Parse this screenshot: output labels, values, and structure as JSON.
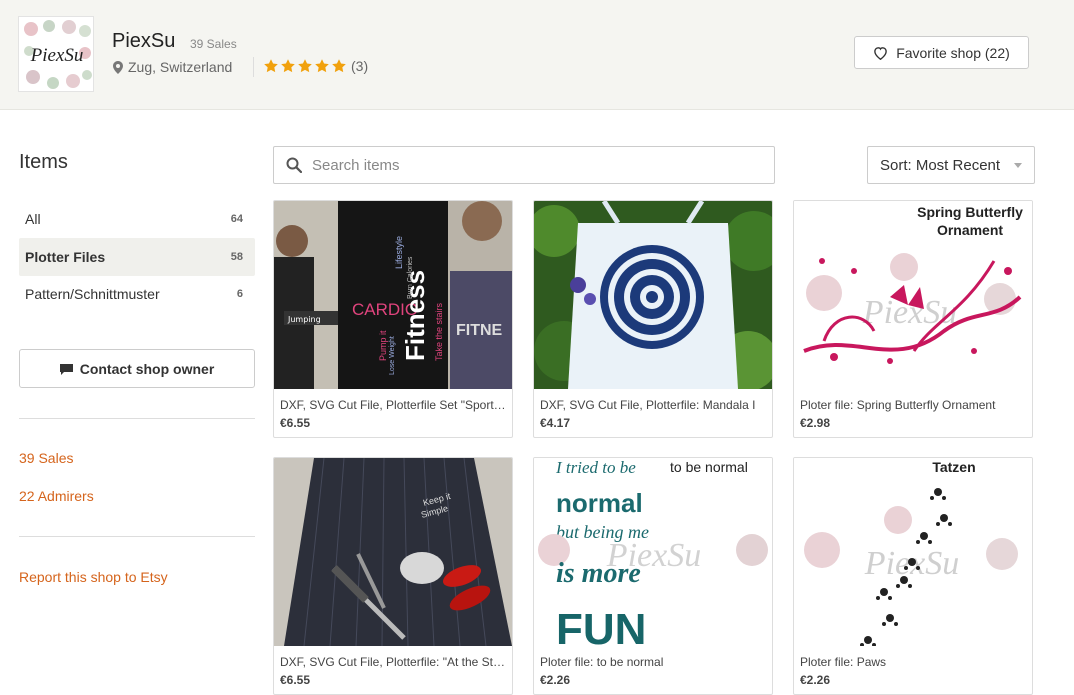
{
  "shop": {
    "name": "PiexSu",
    "sales_small": "39 Sales",
    "location": "Zug, Switzerland",
    "rating_stars": 5,
    "rating_count": "(3)",
    "favorite_label": "Favorite shop (22)",
    "logo_text": "PiexSu"
  },
  "sidebar": {
    "title": "Items",
    "items": [
      {
        "label": "All",
        "count": "64"
      },
      {
        "label": "Plotter Files",
        "count": "58"
      },
      {
        "label": "Pattern/Schnittmuster",
        "count": "6"
      }
    ],
    "contact_label": "Contact shop owner",
    "sales_link": "39 Sales",
    "admirers_link": "22 Admirers",
    "report_link": "Report this shop to Etsy"
  },
  "search": {
    "placeholder": "Search items"
  },
  "sort": {
    "label": "Sort: Most Recent"
  },
  "products": [
    {
      "title": "DXF, SVG Cut File, Plotterfile Set \"Sport Fitness\"",
      "price": "€6.55",
      "image_text": [
        "Lifestyle",
        "CARDIO",
        "Fitness",
        "Take the stairs",
        "Pump it",
        "Lose Weight",
        "FITNE",
        "Burn Calories",
        "Jumping"
      ]
    },
    {
      "title": "DXF, SVG Cut File, Plotterfile: Mandala I",
      "price": "€4.17"
    },
    {
      "title": "Ploter file: Spring Butterfly Ornament",
      "price": "€2.98",
      "image_text": [
        "Spring Butterfly",
        "Ornament",
        "PiexSu"
      ]
    },
    {
      "title": "DXF, SVG Cut File, Plotterfile: \"At the Stove\"",
      "price": "€6.55",
      "image_text": [
        "Keep it",
        "Simple"
      ]
    },
    {
      "title": "Ploter file: to be normal",
      "price": "€2.26",
      "image_text": [
        "I tried to be",
        "to be normal",
        "normal",
        "but being me",
        "is more",
        "FUN",
        "PiexSu"
      ]
    },
    {
      "title": "Ploter file: Paws",
      "price": "€2.26",
      "image_text": [
        "Tatzen",
        "PiexSu"
      ]
    }
  ],
  "colors": {
    "accent_link": "#d5641c",
    "star": "#f1a10d",
    "header_bg": "#f5f5f1",
    "teal_text": "#1b6a6e",
    "magenta": "#c8175d"
  }
}
